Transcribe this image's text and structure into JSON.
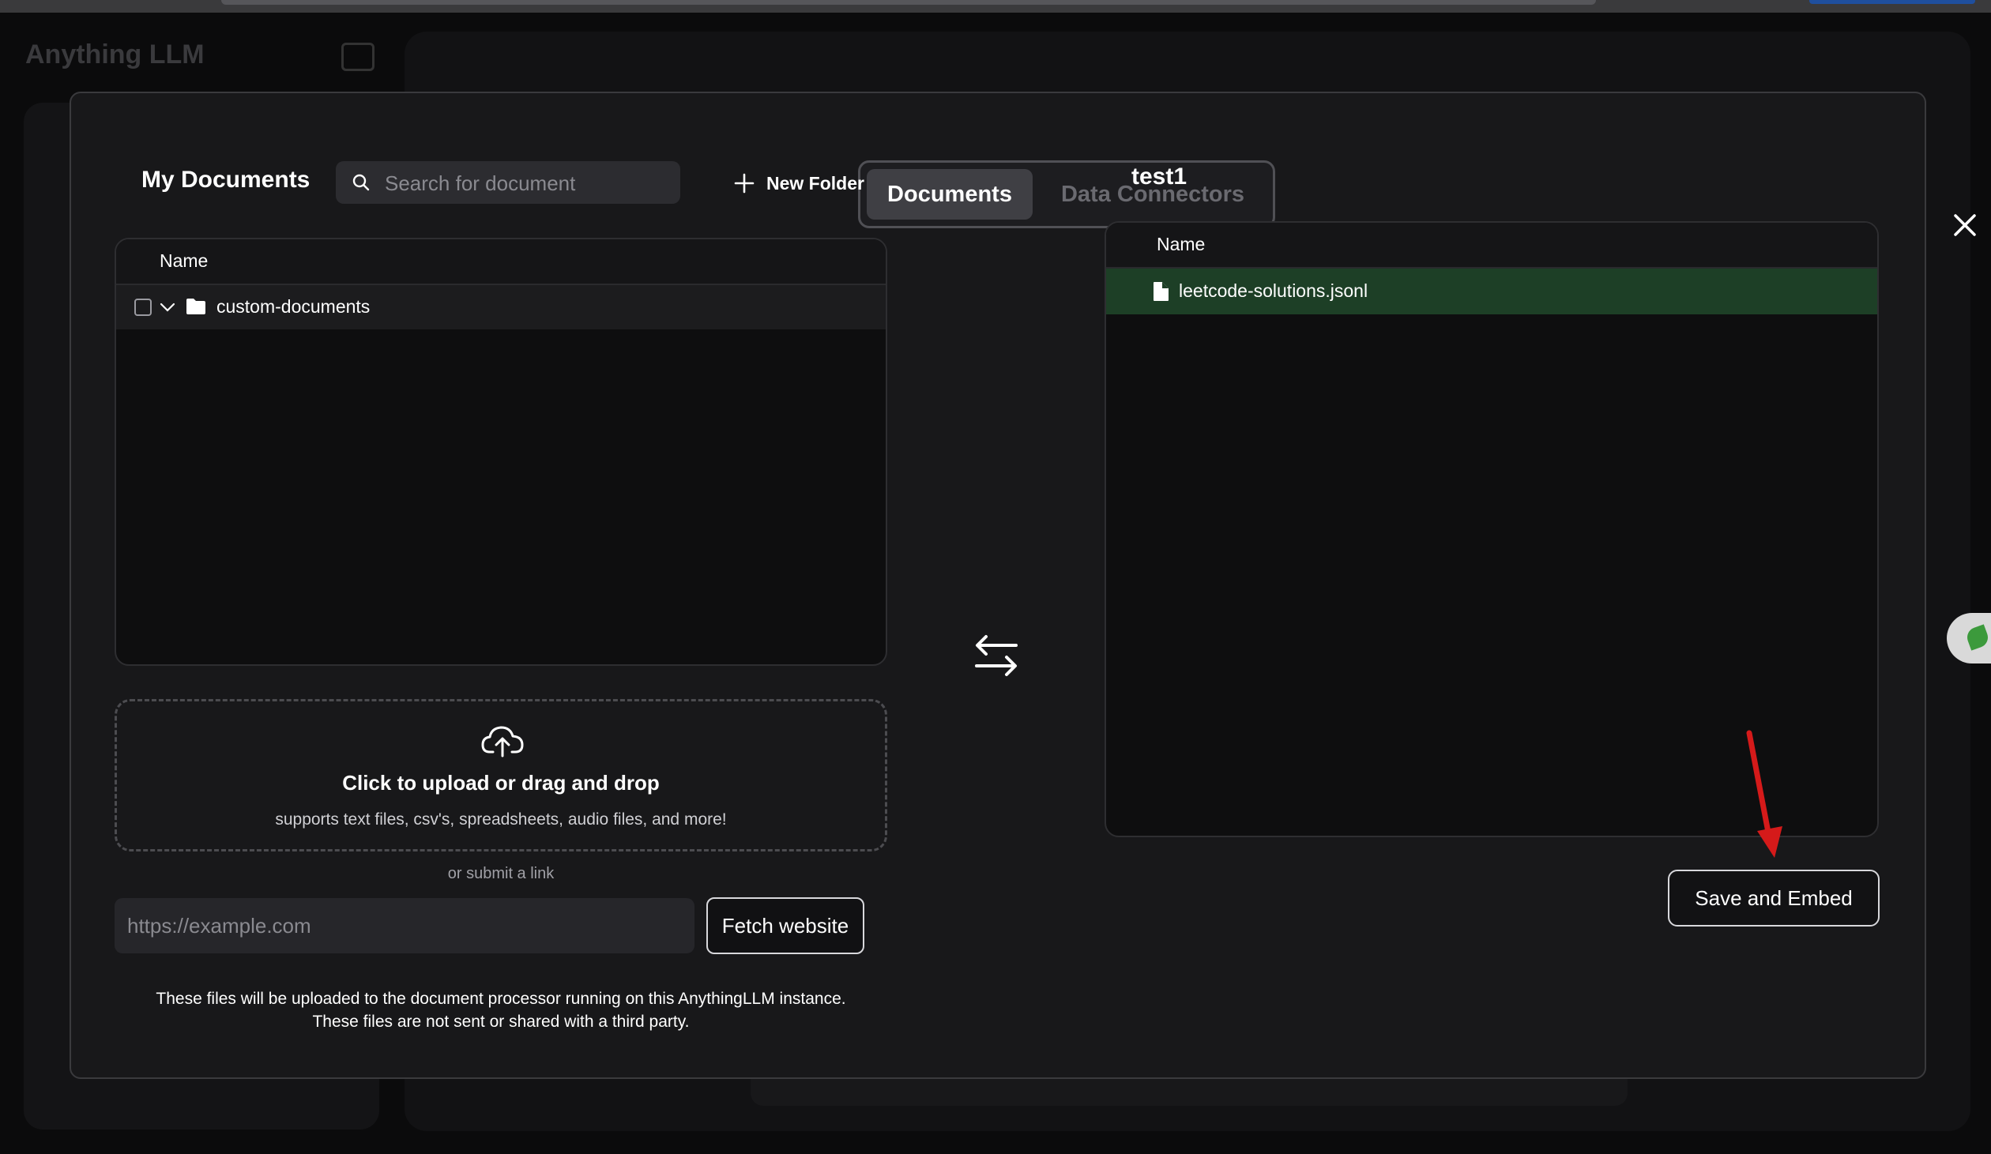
{
  "background": {
    "app_name": "Anything LLM"
  },
  "tabs": [
    {
      "label": "Documents",
      "active": true
    },
    {
      "label": "Data Connectors",
      "active": false
    }
  ],
  "left_panel": {
    "title": "My Documents",
    "search_placeholder": "Search for document",
    "new_folder_label": "New Folder",
    "table_header": "Name",
    "rows": [
      {
        "label": "custom-documents",
        "type": "folder",
        "checked": false,
        "expanded": true
      }
    ]
  },
  "upload": {
    "title": "Click to upload or drag and drop",
    "subtitle": "supports text files, csv's, spreadsheets, audio files, and more!"
  },
  "link": {
    "or_text": "or submit a link",
    "placeholder": "https://example.com",
    "fetch_label": "Fetch website"
  },
  "disclaimer": {
    "line1": "These files will be uploaded to the document processor running on this AnythingLLM instance.",
    "line2": "These files are not sent or shared with a third party."
  },
  "workspace": {
    "title": "test1",
    "table_header": "Name",
    "rows": [
      {
        "label": "leetcode-solutions.jsonl",
        "type": "file"
      }
    ],
    "save_label": "Save and Embed"
  },
  "colors": {
    "modal_bg": "#18181a",
    "selected_row": "#1d3f26",
    "annotation_arrow": "#d51a1a"
  }
}
